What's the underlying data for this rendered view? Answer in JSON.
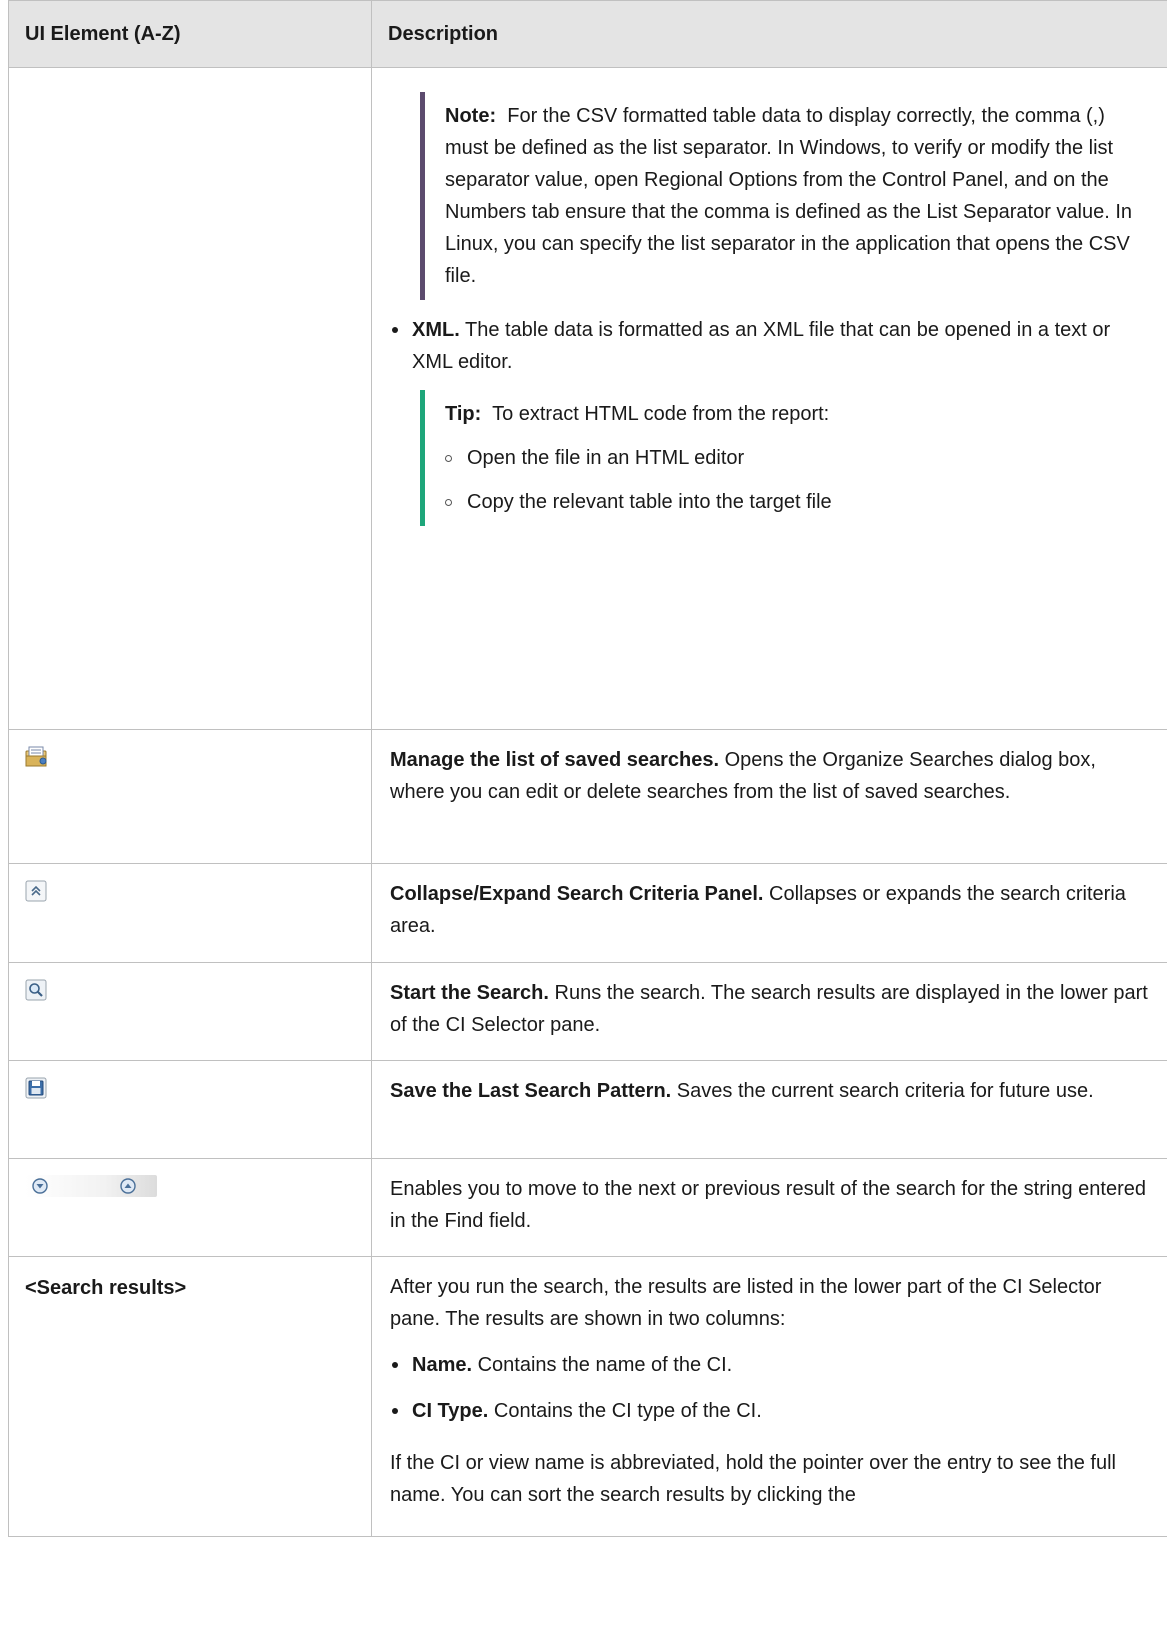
{
  "table": {
    "header_col1": "UI Element (A-Z)",
    "header_col2": "Description"
  },
  "row_export": {
    "note_label": "Note:",
    "note_text": "For the CSV formatted table data to display correctly, the comma (,) must be defined as the list separator. In Windows, to verify or modify the list separator value, open Regional Options from the Control Panel, and on the Numbers tab ensure that the comma is defined as the List Separator value. In Linux, you can specify the list separator in the application that opens the CSV file.",
    "xml_label": "XML.",
    "xml_text": "The table data is formatted as an XML file that can be opened in a text or XML editor.",
    "tip_label": "Tip:",
    "tip_text": "To extract HTML code from the report:",
    "tip_steps": [
      "Open the file in an HTML editor",
      "Copy the relevant table into the target file"
    ]
  },
  "row_manage": {
    "icon": "organize-searches-icon",
    "title": "Manage the list of saved searches.",
    "text": "Opens the Organize Searches dialog box, where you can edit or delete searches from the list of saved searches."
  },
  "row_collapse": {
    "icon": "collapse-expand-icon",
    "title": "Collapse/Expand Search Criteria Panel.",
    "text": "Collapses or expands the search criteria area."
  },
  "row_start": {
    "icon": "magnifier-search-icon",
    "title": "Start the Search.",
    "text": "Runs the search. The search results are displayed in the lower part of the CI Selector pane."
  },
  "row_save": {
    "icon": "floppy-save-icon",
    "title": "Save the Last Search Pattern.",
    "text": "Saves the current search criteria for future use."
  },
  "row_nav": {
    "icons": [
      "next-result-icon",
      "previous-result-icon"
    ],
    "text": "Enables you to move to the next or previous result of the search for the string entered in the Find field."
  },
  "row_results": {
    "element": "<Search results>",
    "intro": "After you run the search, the results are listed in the lower part of the CI Selector pane. The results are shown in two columns:",
    "name_label": "Name.",
    "name_text": "Contains the name of the CI.",
    "type_label": "CI Type.",
    "type_text": "Contains the CI type of the CI.",
    "outro": "If the CI or view name is abbreviated, hold the pointer over the entry to see the full name. You can sort the search results by clicking the"
  },
  "colors": {
    "header_bg": "#e4e4e4",
    "note_bar": "#5c4b6e",
    "tip_bar": "#1ea67a",
    "border": "#c0c0c0"
  }
}
